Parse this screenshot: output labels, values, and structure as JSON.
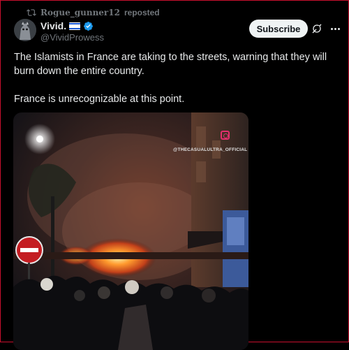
{
  "repost": {
    "user": "Rogue_gunner12",
    "suffix": "reposted",
    "icon": "repost-icon"
  },
  "author": {
    "display_name": "Vivid.",
    "handle": "@VividProwess",
    "flag_icon": "israel-flag-icon",
    "verified_icon": "verified-badge-icon",
    "verified_color": "#1d9bf0"
  },
  "actions": {
    "subscribe_label": "Subscribe",
    "grok_icon": "grok-icon",
    "more_icon": "more-options-icon"
  },
  "tweet": {
    "text": "The Islamists in France are taking to the streets, warning that they will burn down the entire country.\n\nFrance is unrecognizable at this point."
  },
  "media": {
    "watermark": "@THECASUALULTRA_OFFICIAL",
    "watermark_icon": "instagram-icon",
    "description_icon": "no-entry-sign"
  },
  "colors": {
    "background": "#000000",
    "text": "#e7e9ea",
    "muted": "#71767b",
    "frame_border": "#c8102e"
  }
}
